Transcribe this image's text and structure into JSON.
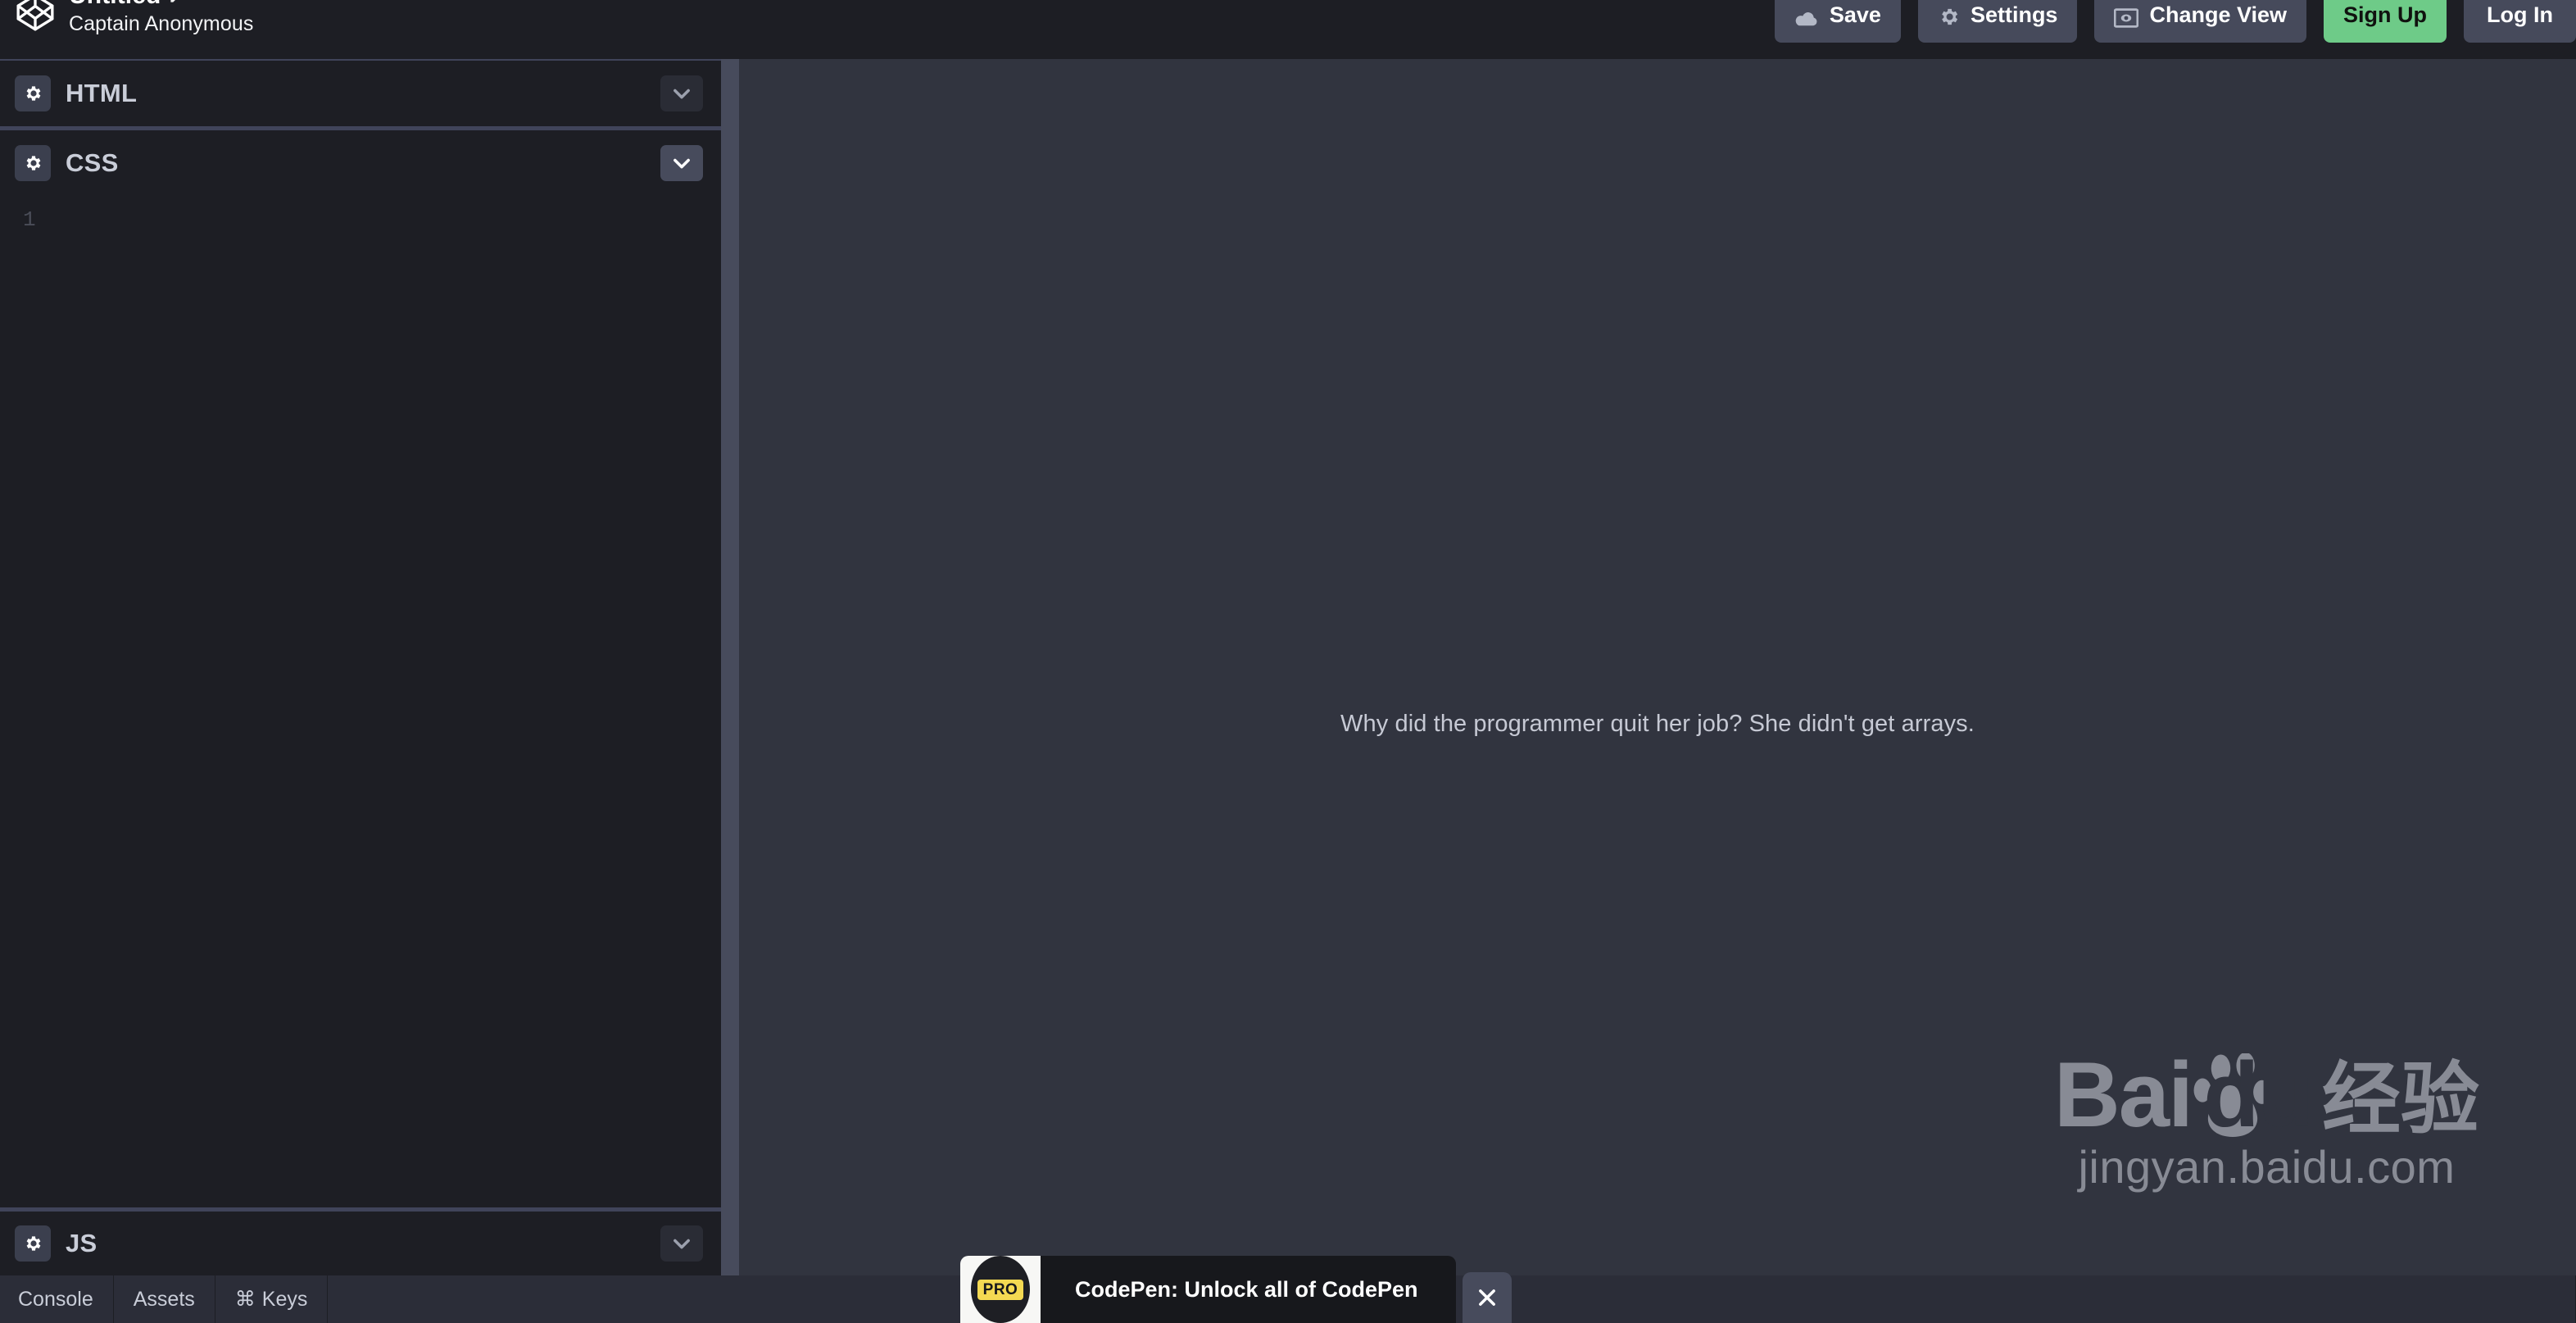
{
  "header": {
    "logo_icon": "codepen-logo-icon",
    "pen_title": "Untitled",
    "edit_icon": "pencil-icon",
    "author": "Captain Anonymous",
    "buttons": [
      {
        "label": "Save",
        "icon": "cloud-icon"
      },
      {
        "label": "Settings",
        "icon": "gear-icon"
      },
      {
        "label": "Change View",
        "icon": "eye-in-frame-icon"
      },
      {
        "label": "Sign Up",
        "icon": ""
      },
      {
        "label": "Log In",
        "icon": ""
      }
    ],
    "signup_color": "#6ecb88",
    "button_color": "#464a5b"
  },
  "editors": {
    "panes": [
      {
        "title": "HTML",
        "settings_icon": "gear-icon",
        "collapse_icon": "chevron-down-icon",
        "line_number": ""
      },
      {
        "title": "CSS",
        "settings_icon": "gear-icon",
        "collapse_icon": "chevron-down-icon",
        "line_number": "1"
      },
      {
        "title": "JS",
        "settings_icon": "gear-icon",
        "collapse_icon": "chevron-down-icon",
        "line_number": ""
      }
    ]
  },
  "preview": {
    "content_text": "Why did the programmer quit her job? She didn't get arrays.",
    "background_color": "#31343f"
  },
  "watermark": {
    "brand_left": "Bai",
    "brand_right": "du",
    "brand_cn": "经验",
    "url": "jingyan.baidu.com"
  },
  "footer": {
    "tabs": [
      {
        "label": "Console",
        "icon": ""
      },
      {
        "label": "Assets",
        "icon": ""
      },
      {
        "label": "Keys",
        "icon": "command-icon"
      }
    ]
  },
  "notification": {
    "badge_text": "PRO",
    "message": "CodePen: Unlock all of CodePen",
    "close_icon": "close-icon"
  }
}
